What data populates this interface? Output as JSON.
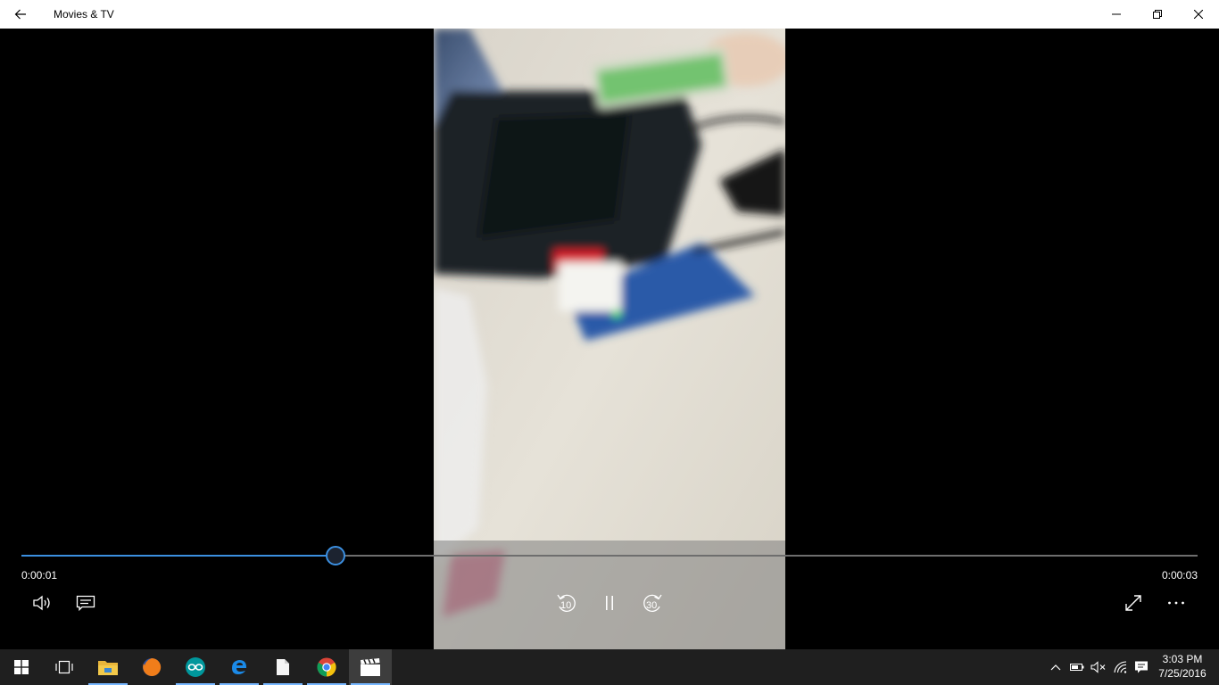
{
  "window": {
    "title": "Movies & TV"
  },
  "player": {
    "elapsed": "0:00:01",
    "total": "0:00:03",
    "progress_fraction": 0.267,
    "skip_back_label": "10",
    "skip_forward_label": "30"
  },
  "taskbar": {
    "apps": [
      {
        "name": "file-explorer",
        "running": true
      },
      {
        "name": "firefox",
        "running": false
      },
      {
        "name": "arduino",
        "running": true
      },
      {
        "name": "edge",
        "running": true
      },
      {
        "name": "notepad",
        "running": true
      },
      {
        "name": "chrome",
        "running": true
      },
      {
        "name": "movies-and-tv",
        "running": true,
        "active": true
      }
    ],
    "clock": {
      "time": "3:03 PM",
      "date": "7/25/2016"
    }
  },
  "colors": {
    "accent": "#3b8fe0",
    "titlebar_bg": "#ffffff",
    "taskbar_bg": "#1f1f1f"
  }
}
